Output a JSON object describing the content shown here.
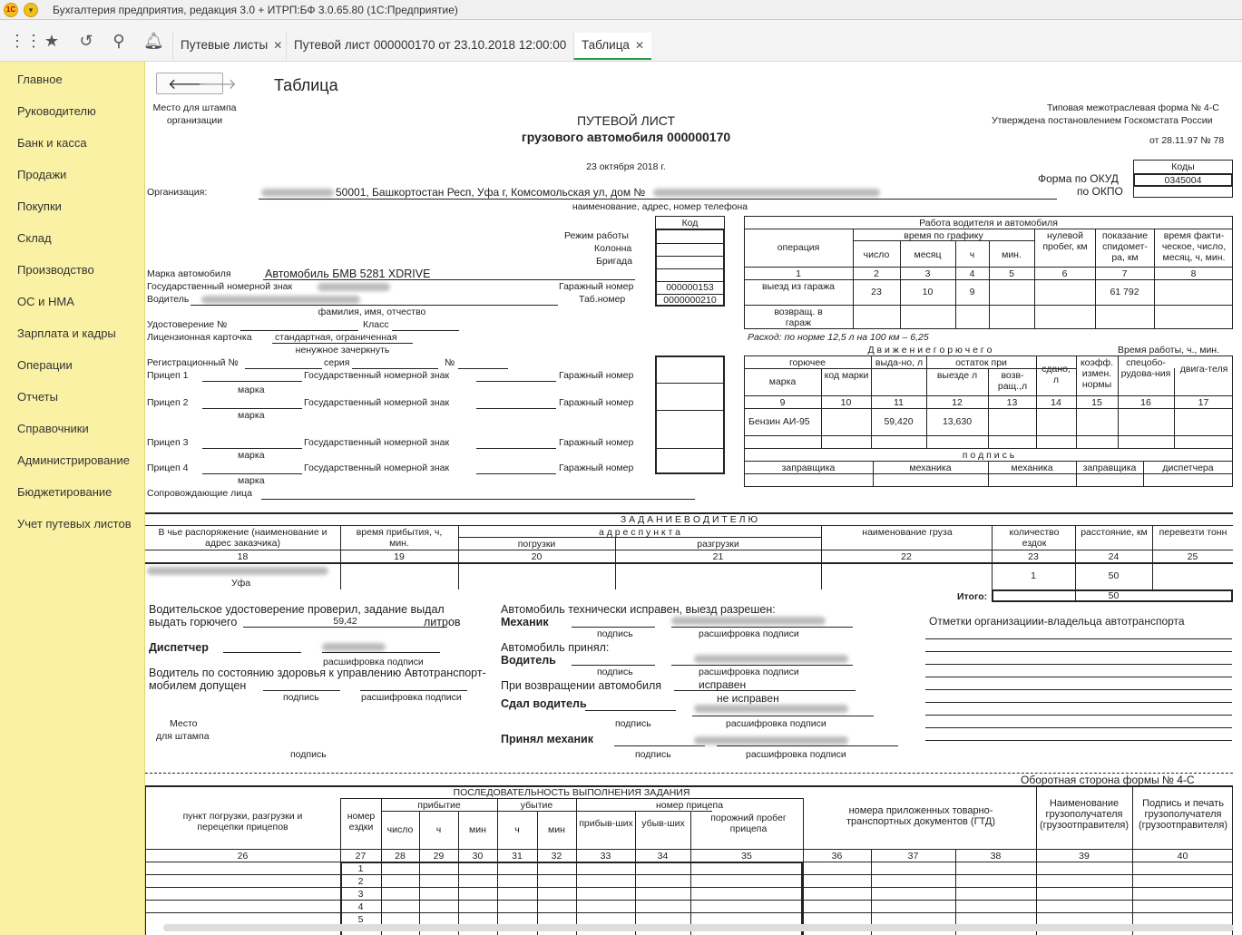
{
  "window": {
    "title": "Бухгалтерия предприятия, редакция 3.0 + ИТРП:БФ 3.0.65.80  (1С:Предприятие)"
  },
  "tabs": [
    {
      "label": "Путевые листы"
    },
    {
      "label": "Путевой лист 000000170 от 23.10.2018 12:00:00"
    },
    {
      "label": "Таблица"
    }
  ],
  "sidebar": {
    "items": [
      "Главное",
      "Руководителю",
      "Банк и касса",
      "Продажи",
      "Покупки",
      "Склад",
      "Производство",
      "ОС и НМА",
      "Зарплата и кадры",
      "Операции",
      "Отчеты",
      "Справочники",
      "Администрирование",
      "Бюджетирование",
      "Учет путевых листов"
    ]
  },
  "page": {
    "title": "Таблица"
  },
  "doc": {
    "stamp_place": "Место для штампа",
    "stamp_org": "организации",
    "title1": "ПУТЕВОЙ ЛИСТ",
    "title2": "грузового автомобиля 000000170",
    "date": "23 октября 2018 г.",
    "form_line1": "Типовая межотраслевая форма № 4-С",
    "form_line2": "Утверждена постановлением Госкомстата России",
    "form_line3": "от 28.11.97 № 78",
    "codes": "Коды",
    "okud_label": "Форма по ОКУД",
    "okud_value": "0345004",
    "okpo_label": "по ОКПО",
    "org_label": "Организация:",
    "org_value": "50001, Башкортостан Респ, Уфа г, Комсомольская ул, дом №",
    "org_caption": "наименование, адрес, номер телефона",
    "kod": "Код",
    "mode": "Режим работы",
    "column": "Колонна",
    "brigade": "Бригада",
    "car_label": "Марка автомобиля",
    "car_value": "Автомобиль БМВ 5281 XDRIVE",
    "gosnum_label": "Государственный номерной знак",
    "garage_label": "Гаражный номер",
    "garage_value": "000000153",
    "driver_label": "Водитель",
    "tab_label": "Таб.номер",
    "tab_value": "0000000210",
    "fio_caption": "фамилия, имя, отчество",
    "license_label": "Удостоверение №",
    "class_label": "Класс",
    "card_label": "Лицензионная карточка",
    "card_value": "стандартная, ограниченная",
    "strike_caption": "ненужное зачеркнуть",
    "reg_label": "Регистрационный №",
    "series_label": "серия",
    "num_label": "№",
    "trailer1": "Прицеп 1",
    "trailer2": "Прицеп 2",
    "trailer3": "Прицеп 3",
    "trailer4": "Прицеп 4",
    "gos_label": "Государственный номерной знак",
    "mark_caption": "марка",
    "escort_label": "Сопровождающие лица",
    "work_header": "Работа водителя и автомобиля",
    "operation": "операция",
    "time_schedule": "время по графику",
    "day": "число",
    "month": "месяц",
    "hour": "ч",
    "min": "мин.",
    "zero_run": "нулевой пробег, км",
    "speedometer": "показание спидомет-ра, км",
    "actual_time": "время факти-ческое, число, месяц, ч, мин.",
    "exit_garage": "выезд из гаража",
    "return_garage": "возвращ. в гараж",
    "exit_day": "23",
    "exit_month": "10",
    "exit_hour": "9",
    "exit_odo": "61 792",
    "consumption": "Расход: по норме 12,5 л на 100 км   –  6,25",
    "fuel_header": "Д в и ж е н и е   г о р ю ч е г о",
    "work_time": "Время работы, ч., мин.",
    "fuel": "горючее",
    "mark": "марка",
    "code_mark": "код марки",
    "issued": "выда-но, л",
    "remain_at": "остаток при",
    "at_exit": "выезде л",
    "at_return": "возв-ращ.,л",
    "handed": "сдано, л",
    "coef": "коэфф. измен. нормы",
    "special": "спецобо-рудова-ния",
    "engine": "двига-теля",
    "fuel_name": "Бензин АИ-95",
    "fuel_issued": "59,420",
    "fuel_exit": "13,630",
    "signatures": "п о д п и с ь",
    "refueler": "заправщика",
    "mechanic": "механика",
    "dispatcher": "диспетчера",
    "task_header": "З А Д А Н И Е   В О Д И Т Е Л Ю",
    "customer": "В чье распоряжение (наименование и адрес заказчика)",
    "arrival_time": "время прибытия, ч, мин.",
    "address": "а д р е с   п у н к т а",
    "loading": "погрузки",
    "unloading": "разгрузки",
    "cargo": "наименование груза",
    "trips": "количество ездок",
    "distance": "расстояние, км",
    "tons": "перевезти тонн",
    "task_customer": "Уфа",
    "task_trips": "1",
    "task_dist": "50",
    "total_label": "Итого:",
    "total_dist": "50",
    "license_check": "Водительское удостоверение проверил, задание выдал",
    "issue_fuel": "выдать горючего",
    "fuel_amount": "59,42",
    "liters": "литров",
    "dispatcher_b": "Диспетчер",
    "sign": "подпись",
    "sign_decode": "расшифровка подписи",
    "health1": "Водитель по состоянию здоровья к управлению Автотранспорт-",
    "health2": "мобилем допущен",
    "place1": "Место",
    "place2": "для штампа",
    "tech_ok": "Автомобиль технически исправен, выезд разрешен:",
    "mechanic_b": "Механик",
    "car_accepted": "Автомобиль принял:",
    "driver_b": "Водитель",
    "on_return": "При возвращении автомобиля",
    "good": "исправен",
    "bad": "не исправен",
    "handed_driver": "Сдал водитель",
    "accepted_mech": "Принял механик",
    "org_marks": "Отметки организациии-владельца автотранспорта",
    "reverse": "Оборотная сторона формы № 4-С",
    "seq_header": "ПОСЛЕДОВАТЕЛЬНОСТЬ ВЫПОЛНЕНИЯ ЗАДАНИЯ",
    "point": "пункт погрузки, разгрузки и перецепки прицепов",
    "trip_no": "номер ездки",
    "arrival": "прибытие",
    "departure": "убытие",
    "trailer_no": "номер прицепа",
    "attached": "прибыв-ших",
    "detached": "убыв-ших",
    "empty_run": "порожний пробег прицепа",
    "docs": "номера приложенных товарно-транспортных документов (ГТД)",
    "consignee": "Наименование грузополучателя (грузоотправителя)",
    "consignee_sign": "Подпись и печать грузополучателя (грузоотправителя)"
  }
}
